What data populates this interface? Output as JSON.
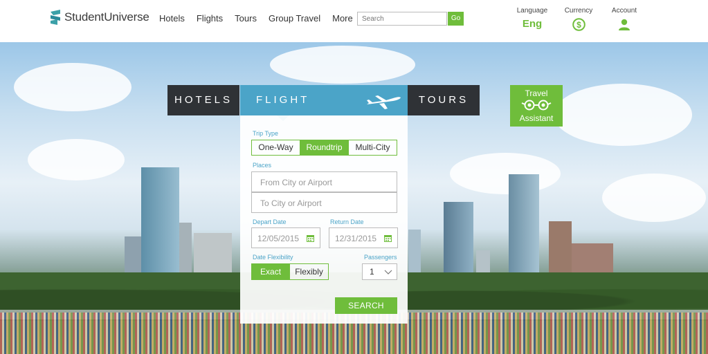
{
  "brand": {
    "name": "StudentUniverse",
    "accent": "#6fbd3b",
    "blue": "#4ba4c8",
    "dark": "#2f3236"
  },
  "nav": [
    "Hotels",
    "Flights",
    "Tours",
    "Group Travel",
    "More"
  ],
  "search": {
    "placeholder": "Search",
    "button": "Go"
  },
  "utilities": {
    "language": {
      "label": "Language",
      "value": "Eng"
    },
    "currency": {
      "label": "Currency",
      "icon": "dollar-circle-icon"
    },
    "account": {
      "label": "Account",
      "icon": "user-icon"
    }
  },
  "tabs": {
    "hotels": "HOTELS",
    "flight": "FLIGHT",
    "tours": "TOURS"
  },
  "travel_assistant": {
    "line1": "Travel",
    "line2": "Assistant",
    "icon": "glasses-icon"
  },
  "form": {
    "trip_type_label": "Trip Type",
    "trip_types": [
      "One-Way",
      "Roundtrip",
      "Multi-City"
    ],
    "selected_trip_type": "Roundtrip",
    "places_label": "Places",
    "from_placeholder": "From City or Airport",
    "to_placeholder": "To City or Airport",
    "depart_label": "Depart Date",
    "depart_value": "12/05/2015",
    "return_label": "Return Date",
    "return_value": "12/31/2015",
    "flex_label": "Date Flexibility",
    "flex_options": [
      "Exact",
      "Flexibly"
    ],
    "selected_flex": "Exact",
    "passengers_label": "Passengers",
    "passengers_value": "1",
    "search_button": "SEARCH"
  }
}
